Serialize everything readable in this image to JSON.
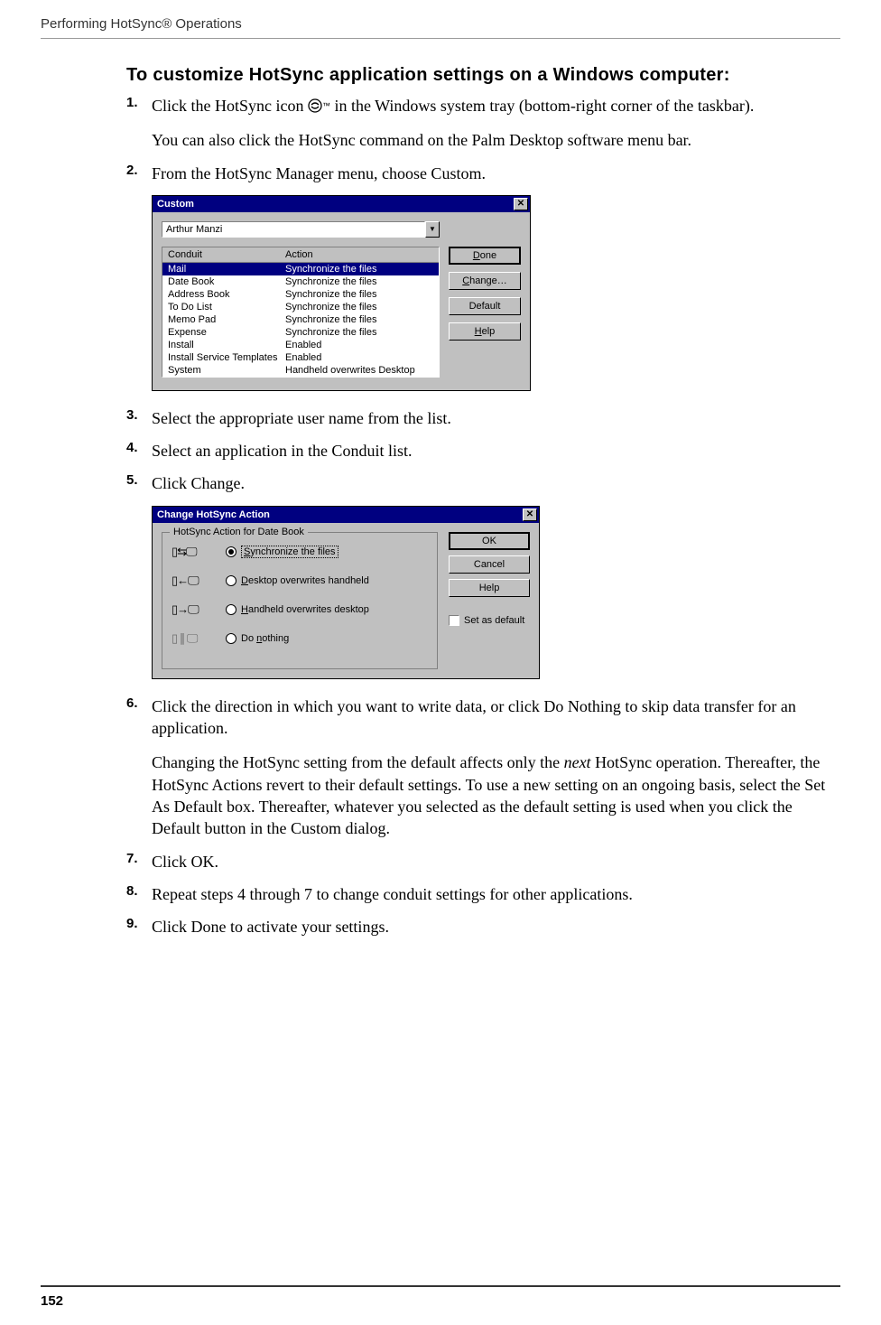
{
  "header": "Performing HotSync® Operations",
  "page_number": "152",
  "section_title": "To customize HotSync application settings on a Windows computer:",
  "steps": {
    "s1": {
      "num": "1.",
      "p1a": "Click the HotSync icon ",
      "p1b": " in the Windows system tray (bottom-right corner of the taskbar).",
      "p2": "You can also click the HotSync command on the Palm Desktop software menu bar."
    },
    "s2": {
      "num": "2.",
      "text": "From the HotSync Manager menu, choose Custom."
    },
    "s3": {
      "num": "3.",
      "text": "Select the appropriate user name from the list."
    },
    "s4": {
      "num": "4.",
      "text": "Select an application in the Conduit list."
    },
    "s5": {
      "num": "5.",
      "text": "Click Change."
    },
    "s6": {
      "num": "6.",
      "p1": "Click the direction in which you want to write data, or click Do Nothing to skip data transfer for an application.",
      "p2a": "Changing the HotSync setting from the default affects only the ",
      "p2_italic": "next",
      "p2b": " HotSync operation. Thereafter, the HotSync Actions revert to their default settings. To use a new setting on an ongoing basis, select the Set As Default box. Thereafter, whatever you selected as the default setting is used when you click the Default button in the Custom dialog."
    },
    "s7": {
      "num": "7.",
      "text": "Click OK."
    },
    "s8": {
      "num": "8.",
      "text": "Repeat steps 4 through 7 to change conduit settings for other applications."
    },
    "s9": {
      "num": "9.",
      "text": "Click Done to activate your settings."
    }
  },
  "dialog1": {
    "title": "Custom",
    "close": "✕",
    "user": "Arthur Manzi",
    "dropdown_arrow": "▼",
    "col_conduit": "Conduit",
    "col_action": "Action",
    "rows": [
      {
        "conduit": "Mail",
        "action": "Synchronize the files",
        "selected": true
      },
      {
        "conduit": "Date Book",
        "action": "Synchronize the files",
        "selected": false
      },
      {
        "conduit": "Address Book",
        "action": "Synchronize the files",
        "selected": false
      },
      {
        "conduit": "To Do List",
        "action": "Synchronize the files",
        "selected": false
      },
      {
        "conduit": "Memo Pad",
        "action": "Synchronize the files",
        "selected": false
      },
      {
        "conduit": "Expense",
        "action": "Synchronize the files",
        "selected": false
      },
      {
        "conduit": "Install",
        "action": "Enabled",
        "selected": false
      },
      {
        "conduit": "Install Service Templates",
        "action": "Enabled",
        "selected": false
      },
      {
        "conduit": "System",
        "action": "Handheld overwrites Desktop",
        "selected": false
      }
    ],
    "btn_done_u": "D",
    "btn_done_rest": "one",
    "btn_change_u": "C",
    "btn_change_rest": "hange…",
    "btn_default": "Default",
    "btn_help_u": "H",
    "btn_help_rest": "elp"
  },
  "dialog2": {
    "title": "Change HotSync Action",
    "close": "✕",
    "legend": "HotSync Action for Date Book",
    "options": [
      {
        "icon": "▯⇆🖵",
        "label_u": "S",
        "label_rest": "ynchronize the files",
        "checked": true,
        "disabled": false
      },
      {
        "icon": "▯←🖵",
        "label_u": "D",
        "label_rest": "esktop overwrites handheld",
        "checked": false,
        "disabled": false
      },
      {
        "icon": "▯→🖵",
        "label_u": "H",
        "label_rest": "andheld overwrites desktop",
        "checked": false,
        "disabled": false
      },
      {
        "icon": "▯ ∥ 🖵",
        "label_pre": "Do ",
        "label_u": "n",
        "label_rest": "othing",
        "checked": false,
        "disabled": true
      }
    ],
    "btn_ok": "OK",
    "btn_cancel": "Cancel",
    "btn_help": "Help",
    "checkbox_label": "Set as default"
  }
}
